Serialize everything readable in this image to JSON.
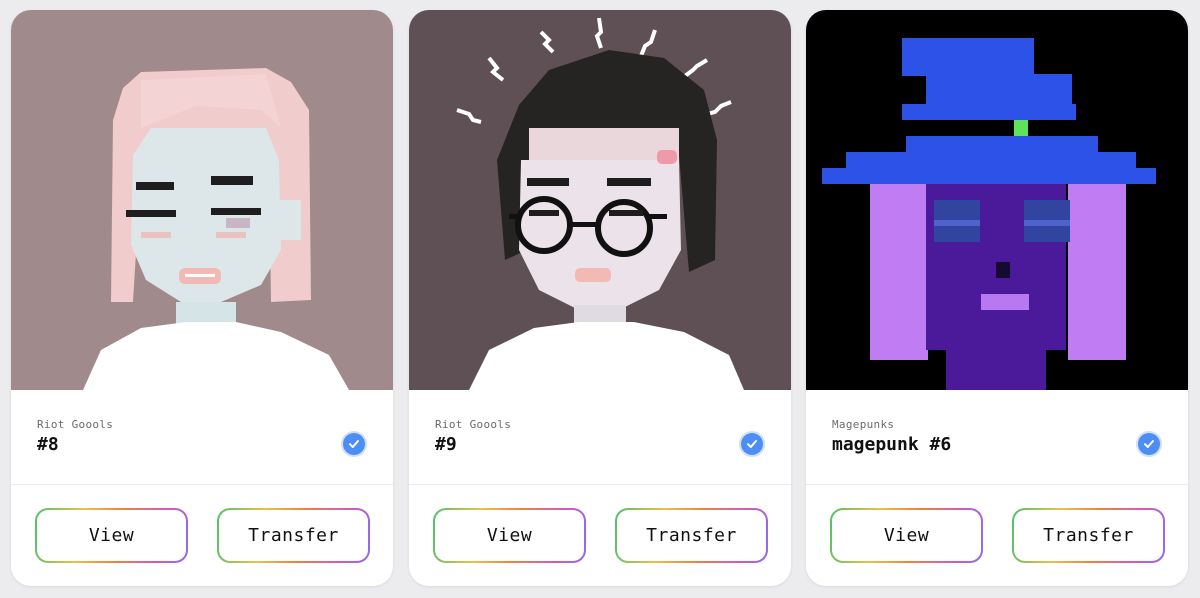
{
  "cards": [
    {
      "collection": "Riot Goools",
      "title": "#8",
      "view_label": "View",
      "transfer_label": "Transfer",
      "image_background": "#a08a8c",
      "verified_color": "#4c8df6"
    },
    {
      "collection": "Riot Goools",
      "title": "#9",
      "view_label": "View",
      "transfer_label": "Transfer",
      "image_background": "#5e5054",
      "verified_color": "#4c8df6"
    },
    {
      "collection": "Magepunks",
      "title": "magepunk #6",
      "view_label": "View",
      "transfer_label": "Transfer",
      "image_background": "#000000",
      "verified_color": "#4c8df6"
    }
  ],
  "icons": {
    "verified": "check-badge-icon"
  }
}
